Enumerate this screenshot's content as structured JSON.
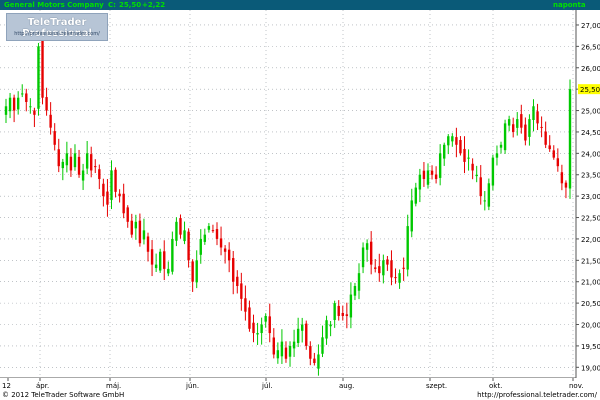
{
  "header": {
    "title": "General Motors Company",
    "close_label": "C:",
    "close_value": "25,50",
    "change": "+2,22",
    "period": "naponta",
    "title_color": "#00e000",
    "change_color": "#00e000",
    "bar_color": "#0a5a78"
  },
  "logo": {
    "brand": "TeleTrader Professional",
    "url": "http://professional.teletrader.com/"
  },
  "footer": {
    "copyright": "© 2012 TeleTrader Software GmbH",
    "url": "http://professional.teletrader.com/"
  },
  "chart_data": {
    "type": "candlestick",
    "title": "General Motors Company",
    "y_tick_labels": [
      "19,00",
      "19,50",
      "20,00",
      "20,50",
      "21,00",
      "21,50",
      "22,00",
      "22,50",
      "23,00",
      "23,50",
      "24,00",
      "24,50",
      "25,00",
      "25,50",
      "26,00",
      "26,50",
      "27,00"
    ],
    "ylim": [
      18.75,
      27.35
    ],
    "x_tick_labels": [
      "12",
      "ápr.",
      "máj.",
      "jún.",
      "júl.",
      "aug.",
      "szept.",
      "okt.",
      "nov."
    ],
    "last_price": 25.5,
    "last_price_label": "25,50",
    "up_color": "#00c800",
    "down_color": "#e60000",
    "grid": true,
    "closes": [
      25.1,
      25.3,
      25.0,
      25.3,
      25.4,
      25.2,
      25.1,
      24.9,
      26.5,
      25.3,
      25.0,
      24.6,
      24.2,
      23.7,
      23.8,
      24.0,
      23.6,
      24.0,
      23.5,
      23.6,
      24.0,
      23.6,
      23.7,
      23.4,
      23.0,
      22.8,
      23.6,
      23.1,
      23.0,
      22.6,
      22.4,
      22.1,
      22.4,
      21.9,
      22.2,
      21.7,
      21.4,
      21.4,
      21.7,
      21.3,
      21.3,
      22.0,
      22.4,
      22.1,
      22.2,
      21.5,
      21.0,
      21.5,
      22.0,
      22.1,
      22.3,
      22.2,
      22.0,
      21.8,
      21.7,
      21.5,
      21.0,
      20.9,
      20.6,
      20.3,
      19.9,
      19.8,
      19.8,
      20.0,
      20.2,
      19.8,
      19.3,
      19.4,
      19.6,
      19.2,
      19.5,
      19.6,
      19.9,
      20.0,
      19.5,
      19.2,
      19.1,
      19.3,
      19.7,
      20.1,
      20.0,
      20.5,
      20.2,
      20.2,
      20.2,
      20.7,
      20.9,
      21.2,
      21.8,
      21.9,
      21.4,
      21.3,
      21.2,
      21.5,
      21.4,
      21.1,
      21.1,
      21.2,
      21.3,
      22.3,
      22.9,
      23.2,
      23.5,
      23.4,
      23.6,
      23.5,
      23.4,
      24.0,
      24.2,
      24.4,
      24.4,
      24.2,
      24.0,
      23.8,
      23.9,
      23.6,
      23.5,
      23.0,
      22.9,
      23.3,
      23.9,
      24.0,
      24.2,
      24.7,
      24.8,
      24.5,
      24.8,
      24.6,
      24.3,
      24.8,
      25.1,
      24.7,
      24.6,
      24.2,
      24.1,
      23.9,
      23.7,
      23.3,
      23.2,
      25.5
    ]
  }
}
